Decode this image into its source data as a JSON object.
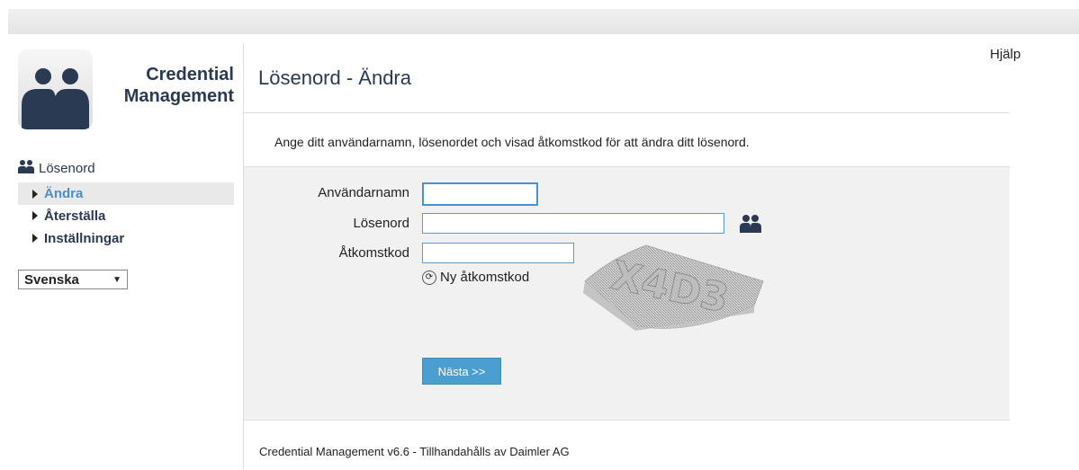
{
  "app": {
    "title_line1": "Credential",
    "title_line2": "Management"
  },
  "nav": {
    "group_label": "Lösenord",
    "items": [
      {
        "label": "Ändra",
        "active": true
      },
      {
        "label": "Återställa",
        "active": false
      },
      {
        "label": "Inställningar",
        "active": false
      }
    ]
  },
  "language": {
    "selected": "Svenska"
  },
  "header": {
    "help_label": "Hjälp",
    "page_title": "Lösenord - Ändra"
  },
  "intro_text": "Ange ditt användarnamn, lösenordet och visad åtkomstkod för att ändra ditt lösenord.",
  "form": {
    "username_label": "Användarnamn",
    "username_value": "",
    "password_label": "Lösenord",
    "password_value": "",
    "code_label": "Åtkomstkod",
    "code_value": "",
    "new_code_label": "Ny åtkomstkod",
    "captcha_text": "X4D3",
    "next_label": "Nästa >>"
  },
  "footer": {
    "text": "Credential Management v6.6 - Tillhandahålls av Daimler AG"
  },
  "colors": {
    "accent": "#4a9fd0",
    "brand": "#2a3a52",
    "active_nav": "#4a8fc8"
  }
}
